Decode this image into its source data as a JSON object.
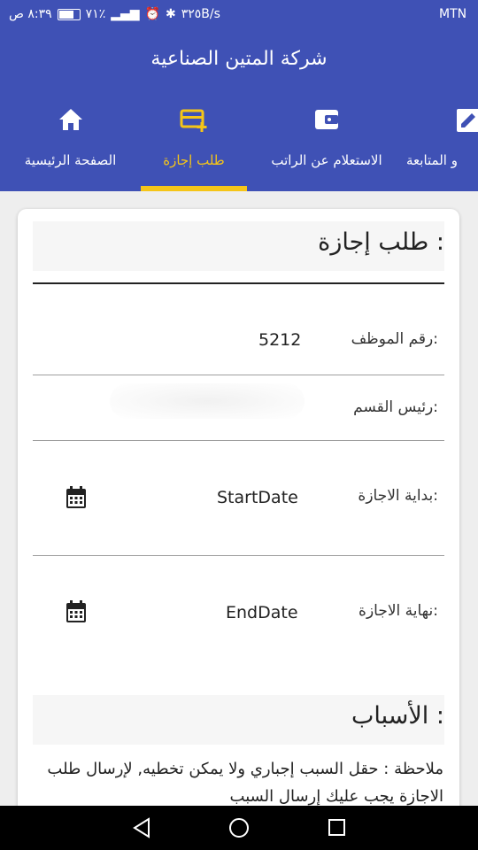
{
  "status_bar": {
    "carrier": "MTN",
    "speed": "٣٢٥B/s",
    "battery_percent": "٧١٪",
    "time": "٨:٣٩ ص"
  },
  "app": {
    "title": "شركة المتين الصناعية"
  },
  "tabs": [
    {
      "label": "الصفحة الرئيسية",
      "icon": "home-icon",
      "active": false
    },
    {
      "label": "طلب إجازة",
      "icon": "add-card-icon",
      "active": true
    },
    {
      "label": "الاستعلام عن الراتب",
      "icon": "wallet-icon",
      "active": false
    },
    {
      "label": "و المتابعة",
      "icon": "edit-icon",
      "active": false
    }
  ],
  "form": {
    "title": "طلب إجازة :",
    "employee_number_label": "رقم الموظف:",
    "employee_number_value": "5212",
    "department_head_label": "رئيس القسم:",
    "start_date_label": "بداية الاجازة:",
    "start_date_value": "StartDate",
    "end_date_label": "نهاية الاجازة:",
    "end_date_value": "EndDate",
    "reasons_title": "الأسباب :",
    "note": "ملاحظة : حقل السبب إجباري ولا يمكن تخطيه, لإرسال طلب الاجازة يجب عليك إرسال السبب"
  },
  "colors": {
    "primary": "#3f51b5",
    "accent": "#f5c518",
    "background": "#eeeeee"
  }
}
